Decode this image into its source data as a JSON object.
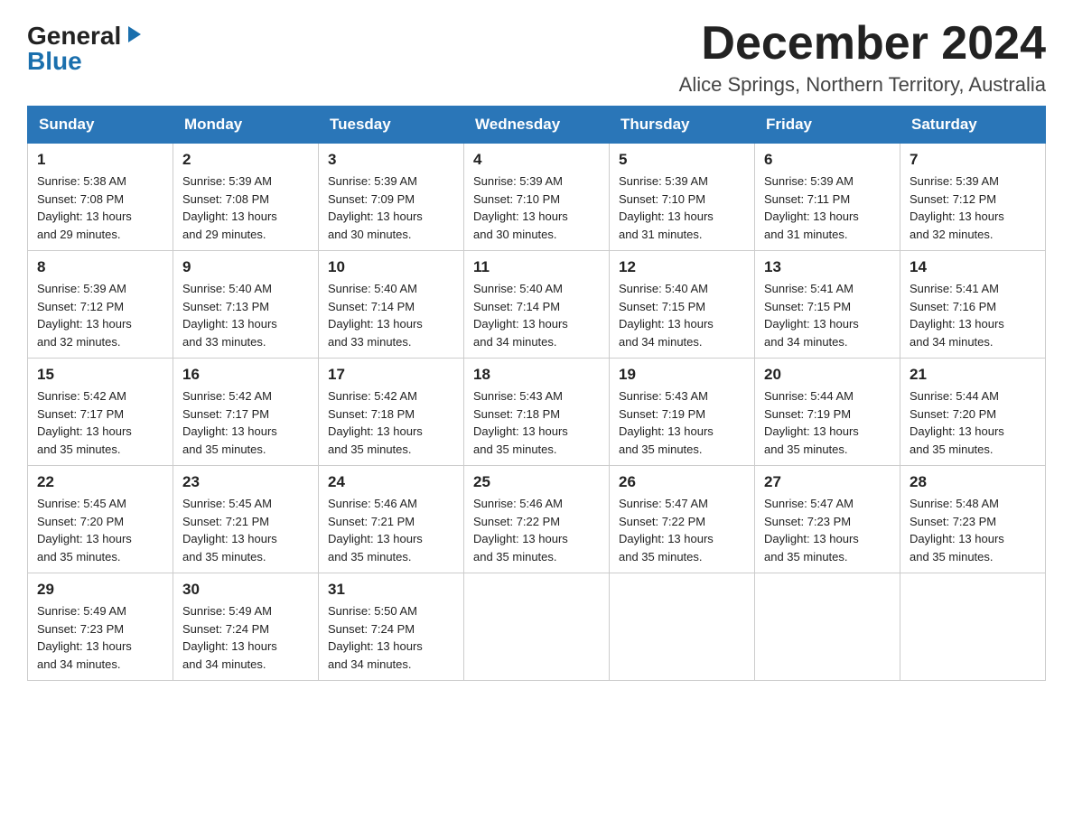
{
  "header": {
    "logo_general": "General",
    "logo_blue": "Blue",
    "month_title": "December 2024",
    "location": "Alice Springs, Northern Territory, Australia"
  },
  "days_of_week": [
    "Sunday",
    "Monday",
    "Tuesday",
    "Wednesday",
    "Thursday",
    "Friday",
    "Saturday"
  ],
  "weeks": [
    [
      {
        "day": "1",
        "sunrise": "5:38 AM",
        "sunset": "7:08 PM",
        "daylight": "13 hours and 29 minutes."
      },
      {
        "day": "2",
        "sunrise": "5:39 AM",
        "sunset": "7:08 PM",
        "daylight": "13 hours and 29 minutes."
      },
      {
        "day": "3",
        "sunrise": "5:39 AM",
        "sunset": "7:09 PM",
        "daylight": "13 hours and 30 minutes."
      },
      {
        "day": "4",
        "sunrise": "5:39 AM",
        "sunset": "7:10 PM",
        "daylight": "13 hours and 30 minutes."
      },
      {
        "day": "5",
        "sunrise": "5:39 AM",
        "sunset": "7:10 PM",
        "daylight": "13 hours and 31 minutes."
      },
      {
        "day": "6",
        "sunrise": "5:39 AM",
        "sunset": "7:11 PM",
        "daylight": "13 hours and 31 minutes."
      },
      {
        "day": "7",
        "sunrise": "5:39 AM",
        "sunset": "7:12 PM",
        "daylight": "13 hours and 32 minutes."
      }
    ],
    [
      {
        "day": "8",
        "sunrise": "5:39 AM",
        "sunset": "7:12 PM",
        "daylight": "13 hours and 32 minutes."
      },
      {
        "day": "9",
        "sunrise": "5:40 AM",
        "sunset": "7:13 PM",
        "daylight": "13 hours and 33 minutes."
      },
      {
        "day": "10",
        "sunrise": "5:40 AM",
        "sunset": "7:14 PM",
        "daylight": "13 hours and 33 minutes."
      },
      {
        "day": "11",
        "sunrise": "5:40 AM",
        "sunset": "7:14 PM",
        "daylight": "13 hours and 34 minutes."
      },
      {
        "day": "12",
        "sunrise": "5:40 AM",
        "sunset": "7:15 PM",
        "daylight": "13 hours and 34 minutes."
      },
      {
        "day": "13",
        "sunrise": "5:41 AM",
        "sunset": "7:15 PM",
        "daylight": "13 hours and 34 minutes."
      },
      {
        "day": "14",
        "sunrise": "5:41 AM",
        "sunset": "7:16 PM",
        "daylight": "13 hours and 34 minutes."
      }
    ],
    [
      {
        "day": "15",
        "sunrise": "5:42 AM",
        "sunset": "7:17 PM",
        "daylight": "13 hours and 35 minutes."
      },
      {
        "day": "16",
        "sunrise": "5:42 AM",
        "sunset": "7:17 PM",
        "daylight": "13 hours and 35 minutes."
      },
      {
        "day": "17",
        "sunrise": "5:42 AM",
        "sunset": "7:18 PM",
        "daylight": "13 hours and 35 minutes."
      },
      {
        "day": "18",
        "sunrise": "5:43 AM",
        "sunset": "7:18 PM",
        "daylight": "13 hours and 35 minutes."
      },
      {
        "day": "19",
        "sunrise": "5:43 AM",
        "sunset": "7:19 PM",
        "daylight": "13 hours and 35 minutes."
      },
      {
        "day": "20",
        "sunrise": "5:44 AM",
        "sunset": "7:19 PM",
        "daylight": "13 hours and 35 minutes."
      },
      {
        "day": "21",
        "sunrise": "5:44 AM",
        "sunset": "7:20 PM",
        "daylight": "13 hours and 35 minutes."
      }
    ],
    [
      {
        "day": "22",
        "sunrise": "5:45 AM",
        "sunset": "7:20 PM",
        "daylight": "13 hours and 35 minutes."
      },
      {
        "day": "23",
        "sunrise": "5:45 AM",
        "sunset": "7:21 PM",
        "daylight": "13 hours and 35 minutes."
      },
      {
        "day": "24",
        "sunrise": "5:46 AM",
        "sunset": "7:21 PM",
        "daylight": "13 hours and 35 minutes."
      },
      {
        "day": "25",
        "sunrise": "5:46 AM",
        "sunset": "7:22 PM",
        "daylight": "13 hours and 35 minutes."
      },
      {
        "day": "26",
        "sunrise": "5:47 AM",
        "sunset": "7:22 PM",
        "daylight": "13 hours and 35 minutes."
      },
      {
        "day": "27",
        "sunrise": "5:47 AM",
        "sunset": "7:23 PM",
        "daylight": "13 hours and 35 minutes."
      },
      {
        "day": "28",
        "sunrise": "5:48 AM",
        "sunset": "7:23 PM",
        "daylight": "13 hours and 35 minutes."
      }
    ],
    [
      {
        "day": "29",
        "sunrise": "5:49 AM",
        "sunset": "7:23 PM",
        "daylight": "13 hours and 34 minutes."
      },
      {
        "day": "30",
        "sunrise": "5:49 AM",
        "sunset": "7:24 PM",
        "daylight": "13 hours and 34 minutes."
      },
      {
        "day": "31",
        "sunrise": "5:50 AM",
        "sunset": "7:24 PM",
        "daylight": "13 hours and 34 minutes."
      },
      null,
      null,
      null,
      null
    ]
  ],
  "labels": {
    "sunrise": "Sunrise:",
    "sunset": "Sunset:",
    "daylight": "Daylight:"
  }
}
